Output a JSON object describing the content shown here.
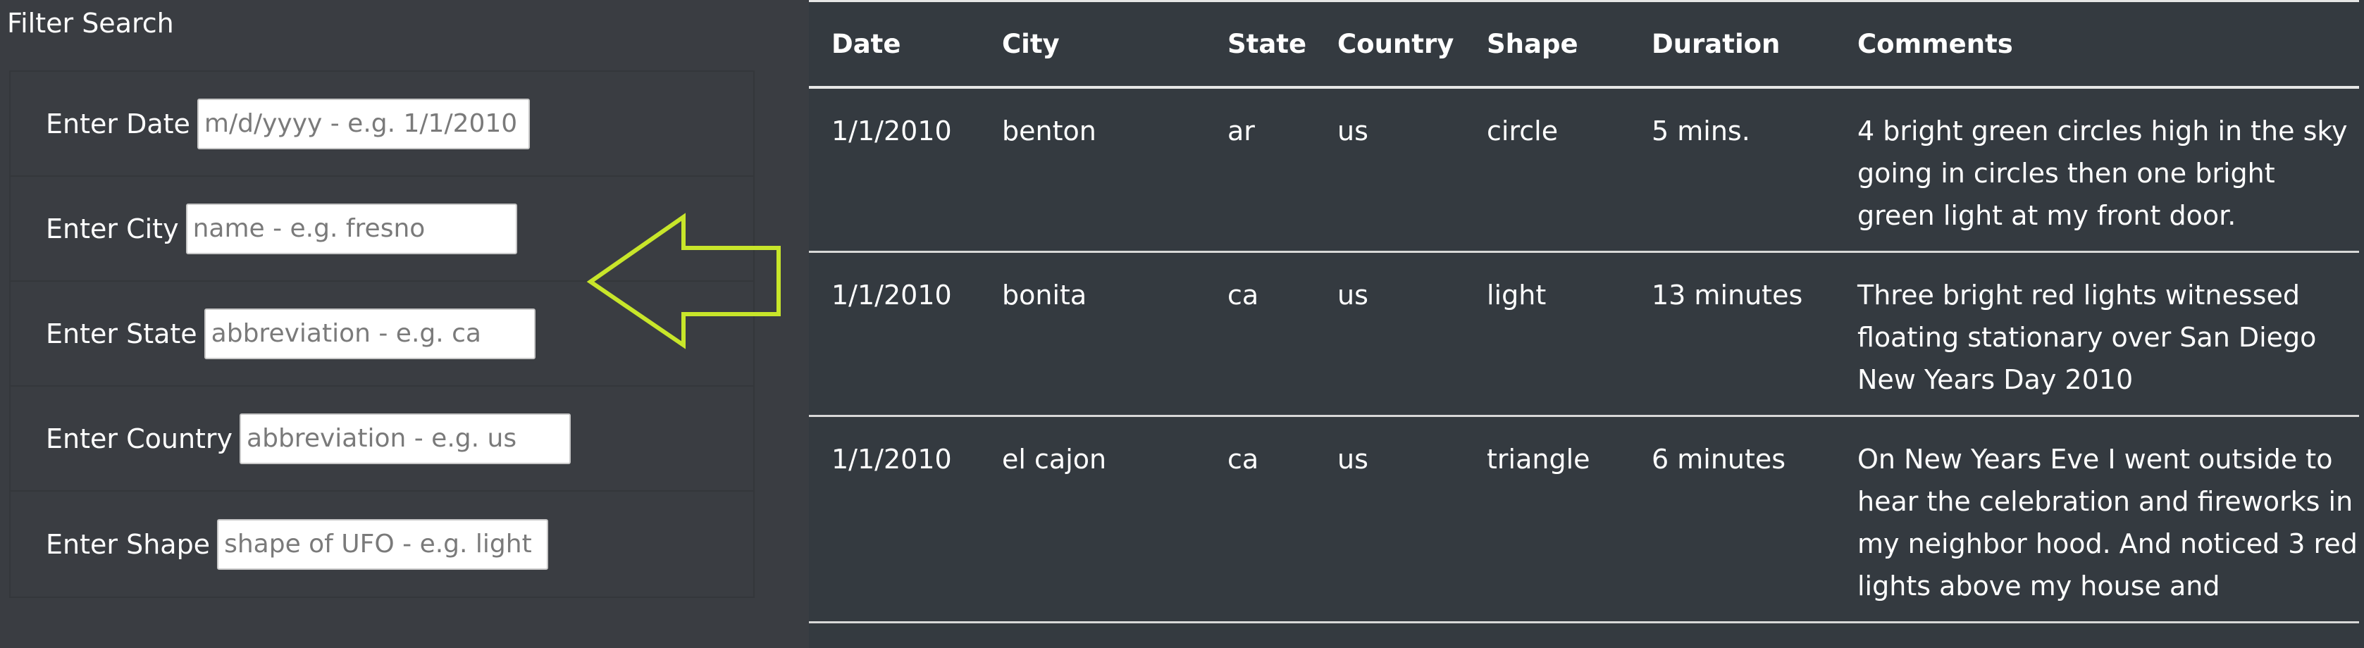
{
  "filter": {
    "title": "Filter Search",
    "fields": [
      {
        "label": "Enter Date",
        "placeholder": "m/d/yyyy - e.g. 1/1/2010",
        "value": ""
      },
      {
        "label": "Enter City",
        "placeholder": "name - e.g. fresno",
        "value": ""
      },
      {
        "label": "Enter State",
        "placeholder": "abbreviation - e.g. ca",
        "value": ""
      },
      {
        "label": "Enter Country",
        "placeholder": "abbreviation - e.g. us",
        "value": ""
      },
      {
        "label": "Enter Shape",
        "placeholder": "shape of UFO - e.g. light",
        "value": ""
      }
    ]
  },
  "annotation": {
    "arrow_color": "#c8e62a",
    "arrow_direction": "left"
  },
  "table": {
    "headers": [
      "Date",
      "City",
      "State",
      "Country",
      "Shape",
      "Duration",
      "Comments"
    ],
    "rows": [
      {
        "date": "1/1/2010",
        "city": "benton",
        "state": "ar",
        "country": "us",
        "shape": "circle",
        "duration": "5 mins.",
        "comments": "4 bright green circles high in the sky going in circles then one bright green light at my front door."
      },
      {
        "date": "1/1/2010",
        "city": "bonita",
        "state": "ca",
        "country": "us",
        "shape": "light",
        "duration": "13 minutes",
        "comments": "Three bright red lights witnessed floating stationary over San Diego New Years Day 2010"
      },
      {
        "date": "1/1/2010",
        "city": "el cajon",
        "state": "ca",
        "country": "us",
        "shape": "triangle",
        "duration": "6 minutes",
        "comments": "On New Years Eve I went outside to hear the celebration and fireworks in my neighbor hood. And noticed 3 red lights above my house and"
      }
    ]
  },
  "colors": {
    "background": "#3a3d42",
    "table_background": "#343a40",
    "text": "#ffffff",
    "row_divider": "#d8d8d8"
  }
}
